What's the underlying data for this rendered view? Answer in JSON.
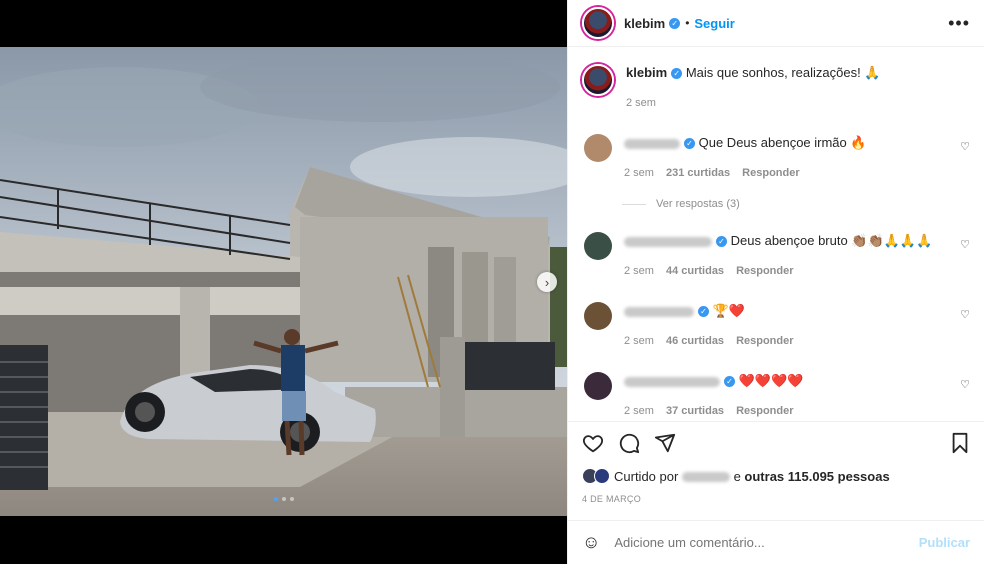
{
  "post": {
    "username": "klebim",
    "follow_label": "Seguir",
    "sep": "•",
    "more_label": "•••",
    "caption": "Mais que sonhos, realizações! 🙏",
    "caption_time": "2 sem"
  },
  "comments": [
    {
      "text": "Que Deus abençoe irmão 🔥",
      "time": "2 sem",
      "likes": "231 curtidas",
      "reply": "Responder",
      "heart": "♡",
      "avatar_color": "#b08a6a",
      "name_width": 56
    },
    {
      "text": "Deus abençoe bruto 👏🏽👏🏽🙏🙏🙏",
      "time": "2 sem",
      "likes": "44 curtidas",
      "reply": "Responder",
      "heart": "♡",
      "avatar_color": "#3a4f45",
      "name_width": 88
    },
    {
      "text": "🏆❤️",
      "time": "2 sem",
      "likes": "46 curtidas",
      "reply": "Responder",
      "heart": "♡",
      "avatar_color": "#6b5237",
      "name_width": 70
    },
    {
      "text": "❤️❤️❤️❤️",
      "time": "2 sem",
      "likes": "37 curtidas",
      "reply": "Responder",
      "heart": "♡",
      "avatar_color": "#3b2a3a",
      "name_width": 96
    }
  ],
  "view_replies": "Ver respostas (3)",
  "likes": {
    "prefix": "Curtido por",
    "middle": "e",
    "others": "outras 115.095 pessoas"
  },
  "date": "4 DE MARÇO",
  "add_comment": {
    "placeholder": "Adicione um comentário...",
    "publish": "Publicar",
    "emoji": "☺"
  },
  "colors": {
    "accent": "#0095f6",
    "verified": "#3897f0",
    "car": "#c9cdd2"
  }
}
